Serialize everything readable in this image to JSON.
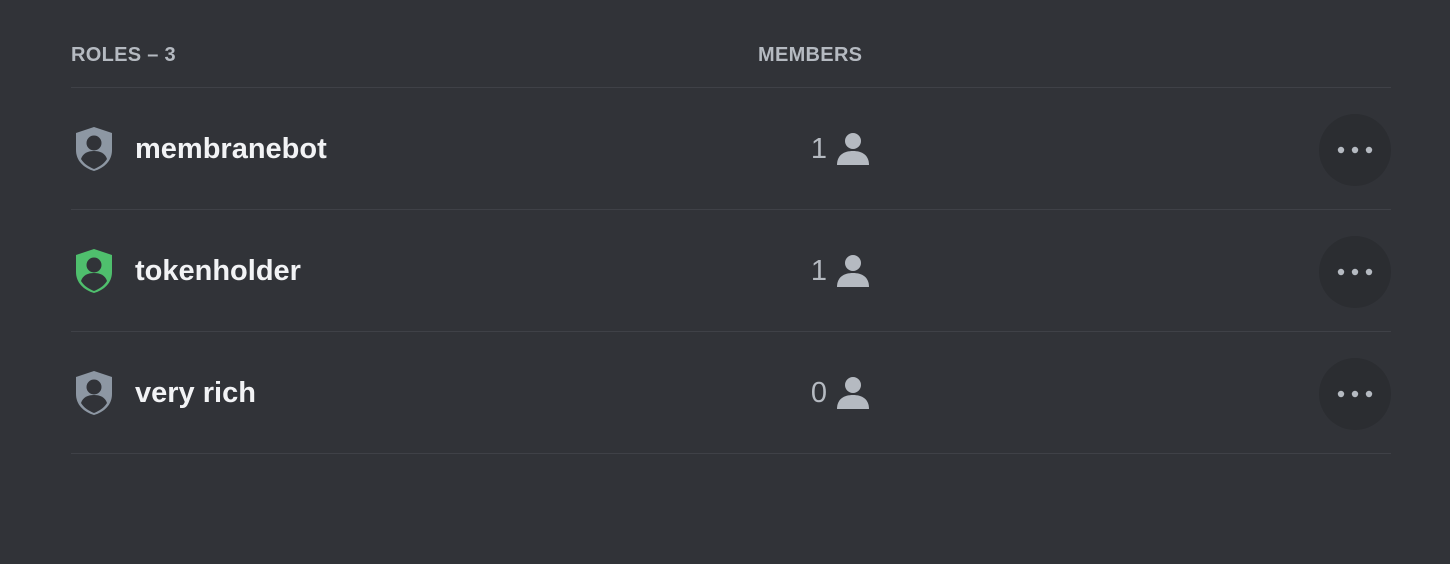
{
  "header": {
    "roles_label": "ROLES – 3",
    "members_label": "MEMBERS"
  },
  "roles": [
    {
      "name": "membranebot",
      "member_count": "1",
      "shield_color": "#8d97a3",
      "shield_icon": "shield-person-icon",
      "more_icon": "ellipsis-icon"
    },
    {
      "name": "tokenholder",
      "member_count": "1",
      "shield_color": "#4fbf6d",
      "shield_icon": "shield-person-icon",
      "more_icon": "ellipsis-icon"
    },
    {
      "name": "very rich",
      "member_count": "0",
      "shield_color": "#8d97a3",
      "shield_icon": "shield-person-icon",
      "more_icon": "ellipsis-icon"
    }
  ],
  "colors": {
    "background": "#313338",
    "divider": "#3f4147",
    "header_text": "#b5bac1",
    "role_text": "#f2f3f5",
    "count_text": "#b5bac1",
    "more_button_bg": "#2b2d31"
  }
}
